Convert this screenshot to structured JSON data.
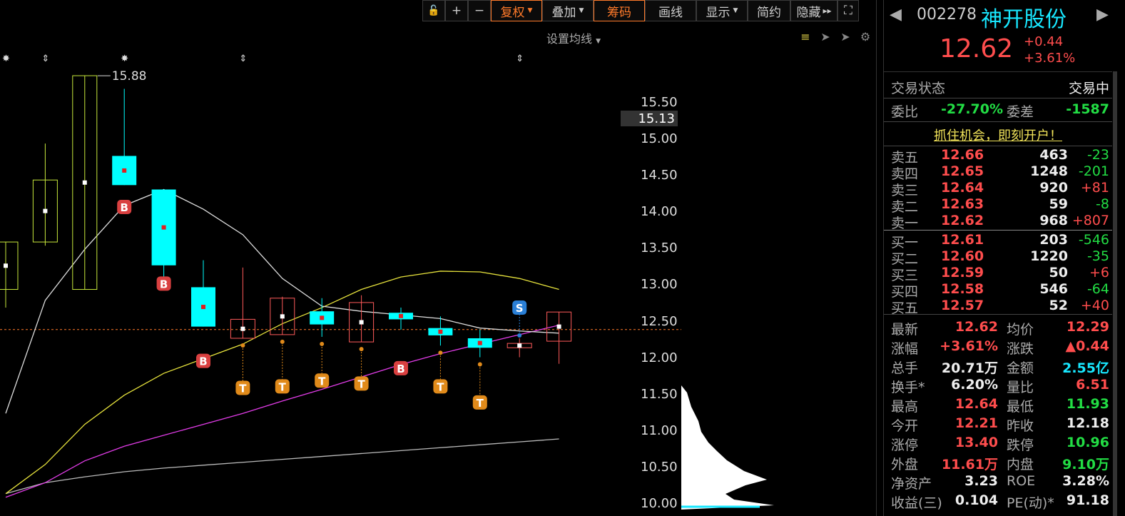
{
  "toolbar": {
    "lock": "🔓",
    "plus": "+",
    "minus": "−",
    "fuquan": "复权",
    "diejia": "叠加",
    "chouma": "筹码",
    "huaxian": "画线",
    "xianshi": "显示",
    "jianyue": "简约",
    "yincang": "隐藏",
    "yincang_arrow": "▸▸",
    "fullscreen": "⛶"
  },
  "ma_setting": "设置均线",
  "chart": {
    "price_ticks": [
      "15.50",
      "15.00",
      "14.50",
      "14.00",
      "13.50",
      "13.00",
      "12.50",
      "12.00",
      "11.50",
      "11.00",
      "10.50",
      "10.00"
    ],
    "current_price_tag": "15.13",
    "high_annotation": "15.88",
    "markers": {
      "B": "B",
      "S": "S",
      "T": "T"
    }
  },
  "chart_data": {
    "type": "candlestick",
    "y_range": [
      9.98,
      16.1
    ],
    "candles": [
      {
        "open": 12.95,
        "high": 13.6,
        "low": 12.7,
        "close": 13.6,
        "color": "yellow"
      },
      {
        "open": 13.6,
        "high": 14.95,
        "low": 13.55,
        "close": 14.45,
        "color": "yellow"
      },
      {
        "open": 12.95,
        "high": 15.88,
        "low": 12.95,
        "close": 15.88,
        "color": "yellow"
      },
      {
        "open": 14.78,
        "high": 15.7,
        "low": 14.38,
        "close": 14.38,
        "color": "cyan"
      },
      {
        "open": 14.32,
        "high": 14.32,
        "low": 13.08,
        "close": 13.28,
        "color": "cyan"
      },
      {
        "open": 12.98,
        "high": 13.35,
        "low": 12.44,
        "close": 12.44,
        "color": "cyan"
      },
      {
        "open": 12.28,
        "high": 13.25,
        "low": 12.28,
        "close": 12.54,
        "color": "red"
      },
      {
        "open": 12.33,
        "high": 12.85,
        "low": 12.33,
        "close": 12.83,
        "color": "red"
      },
      {
        "open": 12.65,
        "high": 12.83,
        "low": 12.3,
        "close": 12.47,
        "color": "cyan"
      },
      {
        "open": 12.23,
        "high": 12.87,
        "low": 12.23,
        "close": 12.77,
        "color": "red"
      },
      {
        "open": 12.63,
        "high": 12.7,
        "low": 12.4,
        "close": 12.54,
        "color": "cyan"
      },
      {
        "open": 12.42,
        "high": 12.58,
        "low": 12.18,
        "close": 12.32,
        "color": "cyan"
      },
      {
        "open": 12.28,
        "high": 12.4,
        "low": 12.02,
        "close": 12.15,
        "color": "cyan"
      },
      {
        "open": 12.21,
        "high": 12.28,
        "low": 12.02,
        "close": 12.15,
        "color": "red"
      },
      {
        "open": 12.24,
        "high": 12.64,
        "low": 11.93,
        "close": 12.64,
        "color": "red"
      }
    ],
    "ma_white": [
      11.25,
      12.8,
      13.5,
      14.1,
      14.32,
      14.05,
      13.7,
      13.1,
      12.72,
      12.65,
      12.6,
      12.55,
      12.42,
      12.38,
      12.35
    ],
    "ma_yellow": [
      10.15,
      10.55,
      11.1,
      11.5,
      11.8,
      12.0,
      12.2,
      12.48,
      12.7,
      12.95,
      13.12,
      13.2,
      13.19,
      13.1,
      12.95
    ],
    "ma_magenta": [
      10.1,
      10.3,
      10.6,
      10.8,
      10.95,
      11.1,
      11.25,
      11.42,
      11.58,
      11.75,
      11.92,
      12.07,
      12.2,
      12.33,
      12.46
    ],
    "ma_gray": [
      10.15,
      10.3,
      10.38,
      10.45,
      10.5,
      10.54,
      10.58,
      10.62,
      10.66,
      10.7,
      10.74,
      10.78,
      10.82,
      10.86,
      10.9
    ],
    "signals": [
      {
        "i": 3,
        "type": "B",
        "price": 14.08
      },
      {
        "i": 4,
        "type": "B",
        "price": 13.03
      },
      {
        "i": 5,
        "type": "B",
        "price": 11.97
      },
      {
        "i": 6,
        "type": "T",
        "price": 11.6
      },
      {
        "i": 7,
        "type": "T",
        "price": 11.62
      },
      {
        "i": 8,
        "type": "T",
        "price": 11.7
      },
      {
        "i": 9,
        "type": "T",
        "price": 11.66
      },
      {
        "i": 10,
        "type": "B",
        "price": 11.87
      },
      {
        "i": 11,
        "type": "T",
        "price": 11.62
      },
      {
        "i": 12,
        "type": "T",
        "price": 11.4
      },
      {
        "i": 13,
        "type": "S",
        "price": 12.7
      }
    ],
    "ref_price": 12.4
  },
  "panel": {
    "code": "002278",
    "name": "神开股份",
    "price": "12.62",
    "change": "+0.44",
    "change_pct": "+3.61%",
    "status_label": "交易状态",
    "status_value": "交易中",
    "weibi_label": "委比",
    "weibi_value": "-27.70%",
    "weicha_label": "委差",
    "weicha_value": "-1587",
    "promo": "抓住机会，即刻开户！",
    "asks": [
      {
        "label": "卖五",
        "price": "12.66",
        "vol": "463",
        "chg": "-23",
        "chg_color": "green"
      },
      {
        "label": "卖四",
        "price": "12.65",
        "vol": "1248",
        "chg": "-201",
        "chg_color": "green"
      },
      {
        "label": "卖三",
        "price": "12.64",
        "vol": "920",
        "chg": "+81",
        "chg_color": "red"
      },
      {
        "label": "卖二",
        "price": "12.63",
        "vol": "59",
        "chg": "-8",
        "chg_color": "green"
      },
      {
        "label": "卖一",
        "price": "12.62",
        "vol": "968",
        "chg": "+807",
        "chg_color": "red"
      }
    ],
    "bids": [
      {
        "label": "买一",
        "price": "12.61",
        "vol": "203",
        "chg": "-546",
        "chg_color": "green"
      },
      {
        "label": "买二",
        "price": "12.60",
        "vol": "1220",
        "chg": "-35",
        "chg_color": "green"
      },
      {
        "label": "买三",
        "price": "12.59",
        "vol": "50",
        "chg": "+6",
        "chg_color": "red"
      },
      {
        "label": "买四",
        "price": "12.58",
        "vol": "546",
        "chg": "-64",
        "chg_color": "green"
      },
      {
        "label": "买五",
        "price": "12.57",
        "vol": "52",
        "chg": "+40",
        "chg_color": "red"
      }
    ],
    "stats": [
      {
        "l1": "最新",
        "v1": "12.62",
        "c1": "red",
        "l2": "均价",
        "v2": "12.29",
        "c2": "red"
      },
      {
        "l1": "涨幅",
        "v1": "+3.61%",
        "c1": "red",
        "l2": "涨跌",
        "v2": "▲0.44",
        "c2": "red"
      },
      {
        "l1": "总手",
        "v1": "20.71万",
        "c1": "white",
        "l2": "金额",
        "v2": "2.55亿",
        "c2": "cyan"
      },
      {
        "l1": "换手*",
        "v1": "6.20%",
        "c1": "white",
        "l2": "量比",
        "v2": "6.51",
        "c2": "red"
      },
      {
        "l1": "最高",
        "v1": "12.64",
        "c1": "red",
        "l2": "最低",
        "v2": "11.93",
        "c2": "green"
      },
      {
        "l1": "今开",
        "v1": "12.21",
        "c1": "red",
        "l2": "昨收",
        "v2": "12.18",
        "c2": "white"
      },
      {
        "l1": "涨停",
        "v1": "13.40",
        "c1": "red",
        "l2": "跌停",
        "v2": "10.96",
        "c2": "green"
      },
      {
        "l1": "外盘",
        "v1": "11.61万",
        "c1": "red",
        "l2": "内盘",
        "v2": "9.10万",
        "c2": "green"
      },
      {
        "l1": "净资产",
        "v1": "3.23",
        "c1": "white",
        "l2": "ROE",
        "v2": "3.28%",
        "c2": "white"
      },
      {
        "l1": "收益(三)",
        "v1": "0.104",
        "c1": "white",
        "l2": "PE(动)*",
        "v2": "91.18",
        "c2": "white"
      }
    ]
  }
}
